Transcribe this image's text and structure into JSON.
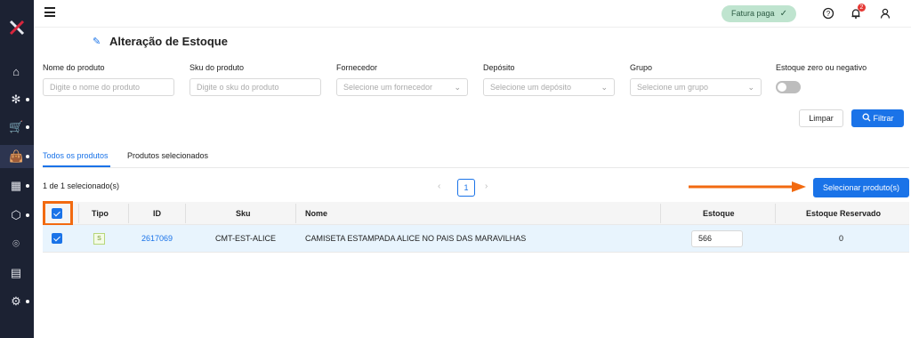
{
  "sidebar": {
    "logo": "x-logo",
    "items": [
      {
        "icon": "home-icon",
        "glyph": "⌂",
        "dot": false,
        "active": false
      },
      {
        "icon": "network-icon",
        "glyph": "✻",
        "dot": true,
        "active": false
      },
      {
        "icon": "cart-icon",
        "glyph": "🛒",
        "dot": true,
        "active": false
      },
      {
        "icon": "shopping-bag-icon",
        "glyph": "👜",
        "dot": true,
        "active": true
      },
      {
        "icon": "store-icon",
        "glyph": "▦",
        "dot": true,
        "active": false
      },
      {
        "icon": "box-icon",
        "glyph": "⬡",
        "dot": true,
        "active": false
      },
      {
        "icon": "scan-icon",
        "glyph": "⌾",
        "dot": false,
        "active": false
      },
      {
        "icon": "clipboard-icon",
        "glyph": "▤",
        "dot": false,
        "active": false
      },
      {
        "icon": "settings-icon",
        "glyph": "⚙",
        "dot": true,
        "active": false
      }
    ]
  },
  "topbar": {
    "status_badge": "Fatura paga",
    "notification_count": "2"
  },
  "page": {
    "title": "Alteração de Estoque"
  },
  "filters": {
    "product_name": {
      "label": "Nome do produto",
      "placeholder": "Digite o nome do produto"
    },
    "product_sku": {
      "label": "Sku do produto",
      "placeholder": "Digite o sku do produto"
    },
    "supplier": {
      "label": "Fornecedor",
      "placeholder": "Selecione um fornecedor"
    },
    "warehouse": {
      "label": "Depósito",
      "placeholder": "Selecione um depósito"
    },
    "group": {
      "label": "Grupo",
      "placeholder": "Selecione um grupo"
    },
    "zero_stock": {
      "label": "Estoque zero ou negativo",
      "enabled": false
    },
    "clear_label": "Limpar",
    "filter_label": "Filtrar"
  },
  "tabs": [
    {
      "label": "Todos os produtos",
      "active": true
    },
    {
      "label": "Produtos selecionados",
      "active": false
    }
  ],
  "selection": {
    "count_text": "1 de 1 selecionado(s)",
    "current_page": "1",
    "select_button": "Selecionar produto(s)"
  },
  "table": {
    "headers": {
      "type": "Tipo",
      "id": "ID",
      "sku": "Sku",
      "name": "Nome",
      "stock": "Estoque",
      "reserved": "Estoque Reservado"
    },
    "rows": [
      {
        "checked": true,
        "type": "S",
        "id": "2617069",
        "sku": "CMT-EST-ALICE",
        "name": "CAMISETA ESTAMPADA ALICE NO PAIS DAS MARAVILHAS",
        "stock": "566",
        "reserved": "0"
      }
    ]
  },
  "colors": {
    "accent": "#1a73e8",
    "sidebar_bg": "#1c2233",
    "annotation": "#f26a10",
    "paid_badge_bg": "#bfe4cf"
  }
}
